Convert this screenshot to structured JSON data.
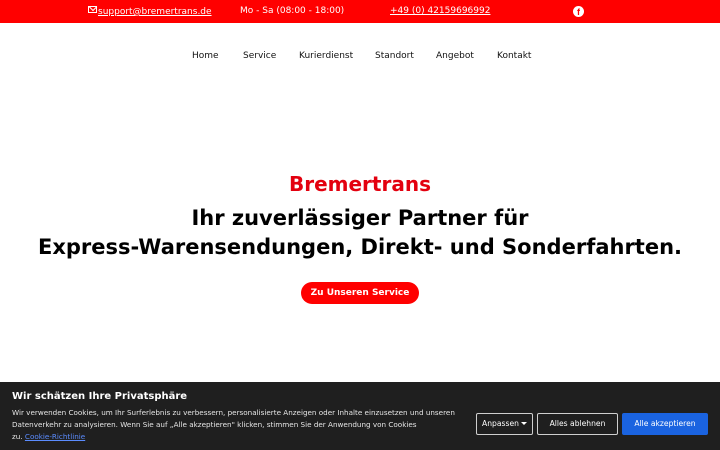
{
  "topbar": {
    "email": "support@bremertrans.de",
    "hours": "Mo - Sa (08:00 - 18:00)",
    "phone": "+49 (0) 42159696992",
    "email_icon": "mail-icon",
    "social_icon": "facebook-icon",
    "background": "#ff0000"
  },
  "nav": {
    "items": [
      "Home",
      "Service",
      "Kurierdienst",
      "Standort",
      "Angebot",
      "Kontakt"
    ]
  },
  "hero": {
    "brand": "Bremertrans",
    "tagline_line1": "Ihr zuverlässiger Partner für",
    "tagline_line2": "Express-Warensendungen, Direkt- und Sonderfahrten.",
    "cta": "Zu Unseren Service",
    "brand_color": "#e3000f"
  },
  "cookie": {
    "title": "Wir schätzen Ihre Privatsphäre",
    "text_line1": "Wir verwenden Cookies, um Ihr Surferlebnis zu verbessern, personalisierte Anzeigen oder Inhalte einzusetzen und unseren",
    "text_line2": "Datenverkehr zu analysieren. Wenn Sie auf „Alle akzeptieren\" klicken, stimmen Sie der Anwendung von Cookies",
    "text_line3_prefix": "zu.",
    "policy_link": "Cookie-Richtlinie",
    "customize_label": "Anpassen",
    "reject_label": "Alles ablehnen",
    "accept_label": "Alle akzeptieren",
    "accept_color": "#1a63e0"
  }
}
